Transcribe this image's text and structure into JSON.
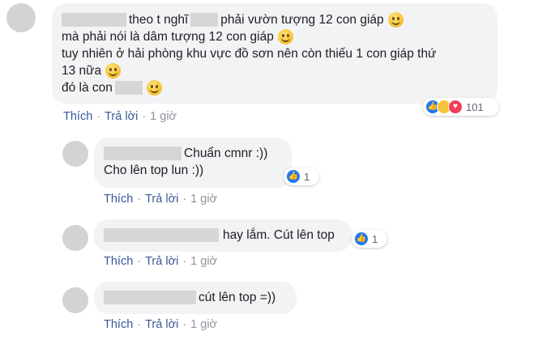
{
  "comments": [
    {
      "lines": [
        {
          "before": "",
          "after": "theo t nghĩ",
          "after2": "phải vườn tượng 12 con giáp"
        },
        {
          "text": "mà phải nói là dâm tượng 12 con giáp"
        },
        {
          "text": "tuy nhiên ở hải phòng khu vực đồ sơn nên còn thiếu 1 con giáp thứ"
        },
        {
          "text": "13 nữa"
        },
        {
          "text": "đó là con"
        }
      ],
      "reaction_count": "101",
      "actions": {
        "like": "Thích",
        "reply": "Trả lời",
        "sep": "·",
        "time": "1 giờ"
      }
    },
    {
      "lines": [
        {
          "text": "Chuẩn cmnr :))"
        },
        {
          "text": "Cho lên top lun :))"
        }
      ],
      "reaction_count": "1",
      "actions": {
        "like": "Thích",
        "reply": "Trả lời",
        "sep": "·",
        "time": "1 giờ"
      }
    },
    {
      "lines": [
        {
          "text": "hay lắm. Cút lên top"
        }
      ],
      "reaction_count": "1",
      "actions": {
        "like": "Thích",
        "reply": "Trả lời",
        "sep": "·",
        "time": "1 giờ"
      }
    },
    {
      "lines": [
        {
          "text": "cút lên top =))"
        }
      ],
      "actions": {
        "like": "Thích",
        "reply": "Trả lời",
        "sep": "·",
        "time": "1 giờ"
      }
    }
  ],
  "icons": {
    "smiley": "smiley-emoji-icon",
    "like": "like-reaction-icon",
    "haha": "haha-reaction-icon",
    "love": "love-reaction-icon"
  },
  "colors": {
    "bubble": "#f2f3f5",
    "link": "#385898",
    "like_reaction": "#2078f4",
    "love_reaction": "#f33e58",
    "haha_reaction": "#f7c33b"
  }
}
